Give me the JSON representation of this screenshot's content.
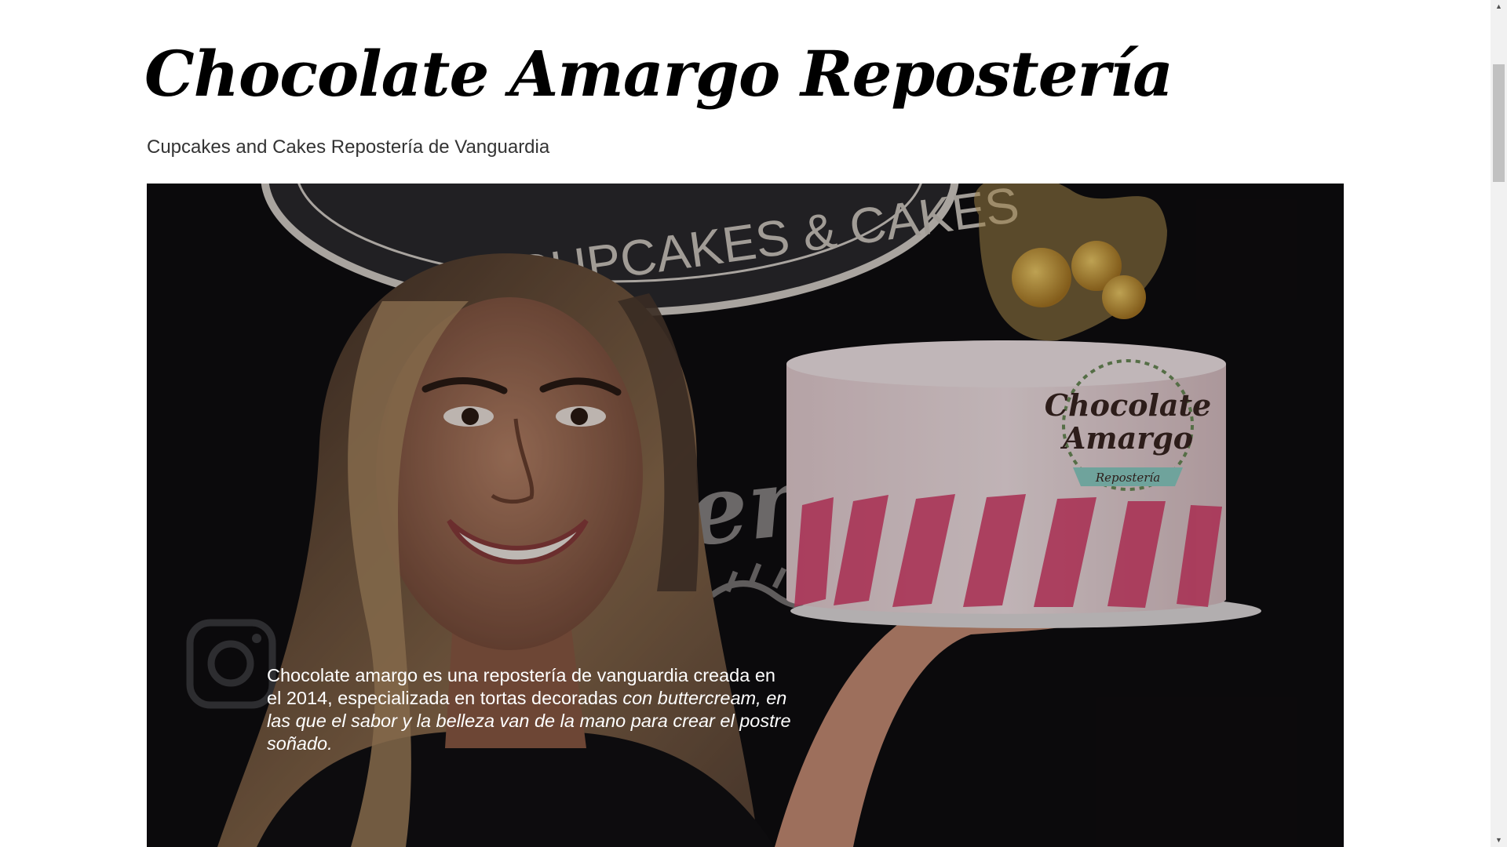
{
  "site": {
    "title": "Chocolate Amargo Repostería",
    "tagline": "Cupcakes and Cakes Repostería de Vanguardia"
  },
  "hero": {
    "text_plain": "Chocolate amargo es una repostería de vanguardia creada en el 2014, especializada en tortas decoradas ",
    "text_italic": "con buttercream, en las que el sabor y la belleza van de la mano para crear el postre soñado.",
    "background_sign_text": "CUPCAKES & CAKES",
    "background_wall_text": "enos!",
    "cake_logo_line1": "Chocolate",
    "cake_logo_line2": "Amargo",
    "cake_logo_banner": "Repostería",
    "colors": {
      "background": "#0f0d10",
      "cake": "#f3dfe2",
      "cake_stripes": "#d9436f",
      "logo_banner": "#8fd1c8"
    }
  },
  "scrollbar": {
    "up_icon": "triangle-up-icon",
    "down_icon": "triangle-down-icon"
  }
}
